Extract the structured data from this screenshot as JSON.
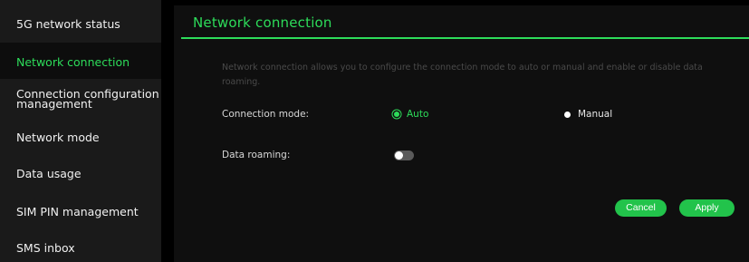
{
  "sidebar": {
    "items": [
      {
        "label": "5G network status"
      },
      {
        "label": "Network connection"
      },
      {
        "label": "Connection configuration management"
      },
      {
        "label": "Network mode"
      },
      {
        "label": "Data usage"
      },
      {
        "label": "SIM PIN management"
      },
      {
        "label": "SMS inbox"
      }
    ],
    "active_index": 1
  },
  "main": {
    "title": "Network connection",
    "description": "Network connection allows you to configure the connection mode to auto or manual and enable or disable data roaming.",
    "connection_mode": {
      "label": "Connection mode:",
      "options": [
        "Auto",
        "Manual"
      ],
      "selected": "Auto"
    },
    "data_roaming": {
      "label": "Data roaming:",
      "enabled": false
    },
    "buttons": {
      "cancel": "Cancel",
      "apply": "Apply"
    }
  },
  "colors": {
    "accent": "#2ddc5a",
    "button": "#22c34b",
    "sidebar_bg": "#1a1a1a",
    "main_bg": "#0f0f0f"
  }
}
